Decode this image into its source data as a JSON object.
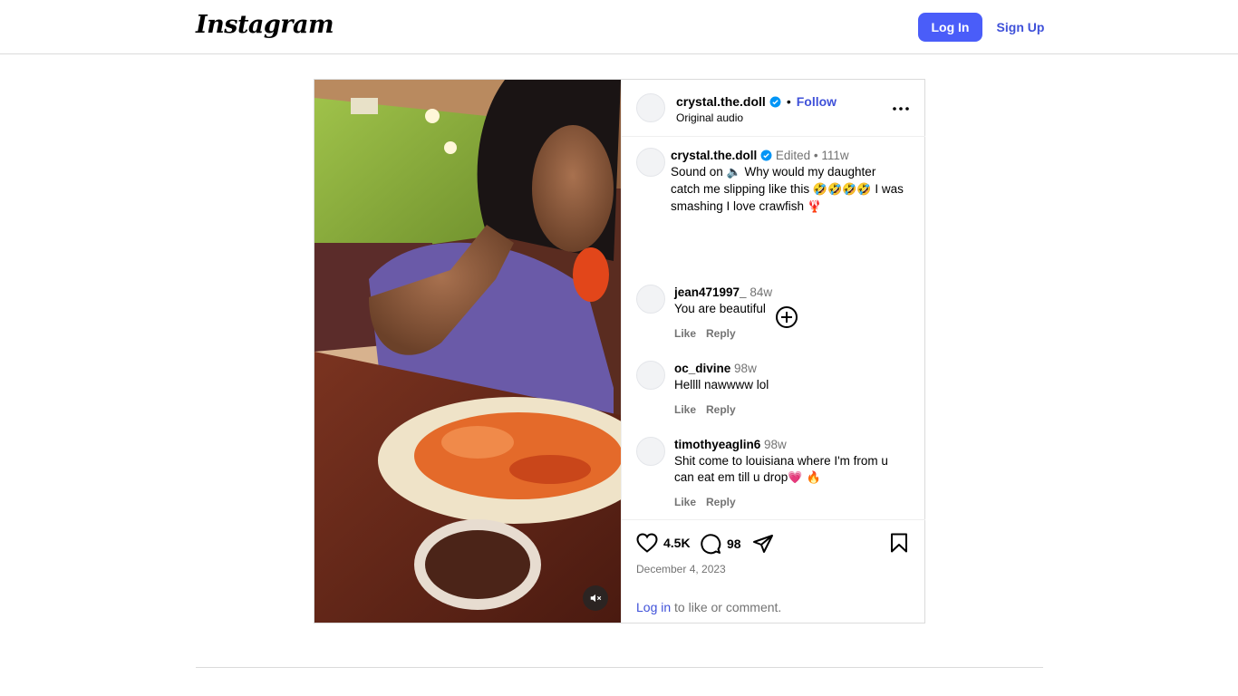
{
  "nav": {
    "logo_text": "Instagram",
    "login_label": "Log In",
    "signup_label": "Sign Up"
  },
  "post": {
    "author": "crystal.the.doll",
    "follow_label": "Follow",
    "audio_label": "Original audio",
    "caption": {
      "username": "crystal.the.doll",
      "edited_label": "Edited",
      "age": "111w",
      "text_part1": "Sound on ",
      "text_part2": " Why would my daughter catch me slipping like this ",
      "laugh_emojis": "🤣🤣🤣🤣",
      "text_part3": " I was smashing I love crawfish ",
      "crawfish_emoji": "🦞",
      "speaker_emoji": "🔈"
    },
    "comments": [
      {
        "username": "jean471997_",
        "age": "84w",
        "text": "You are beautiful",
        "like": "Like",
        "reply": "Reply"
      },
      {
        "username": "oc_divine",
        "age": "98w",
        "text": "Hellll nawwww lol",
        "like": "Like",
        "reply": "Reply"
      },
      {
        "username": "timothyeaglin6",
        "age": "98w",
        "text": "Shit come to louisiana where I'm from u can eat em till u drop",
        "emoji": "💗 🔥",
        "like": "Like",
        "reply": "Reply"
      }
    ],
    "likes_count": "4.5K",
    "comments_count": "98",
    "date": "December 4, 2023",
    "login_link": "Log in",
    "login_hint_rest": " to like or comment."
  },
  "colors": {
    "accent": "#4a5df9",
    "link": "#3f51d9",
    "verified": "#0095f6",
    "muted": "#737373"
  },
  "icons": [
    "heart-icon",
    "comment-icon",
    "share-icon",
    "bookmark-icon",
    "more-icon",
    "add-circle-icon",
    "mute-icon",
    "verified-badge-icon"
  ]
}
